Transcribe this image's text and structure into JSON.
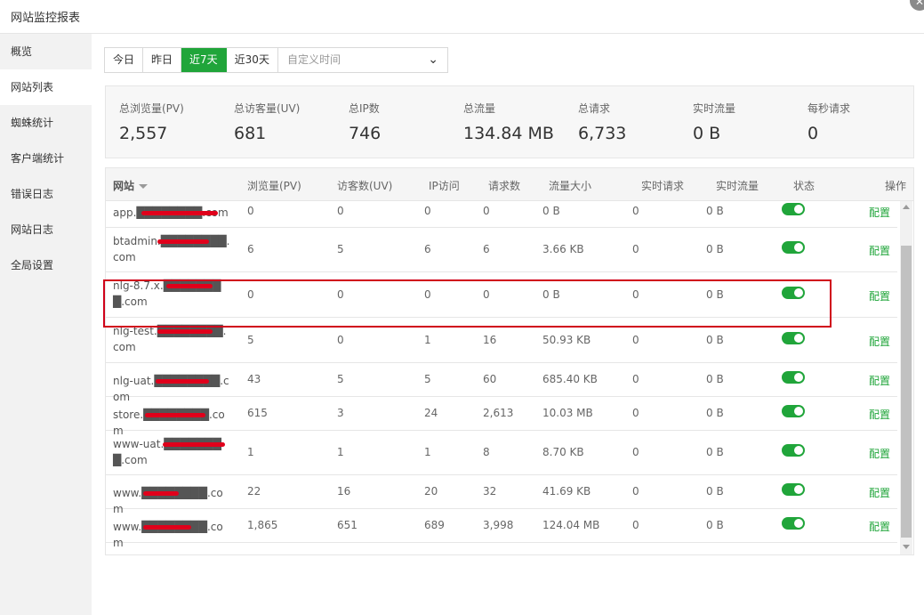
{
  "window": {
    "title": "网站监控报表",
    "close_symbol": "✕"
  },
  "sidebar": {
    "items": [
      {
        "label": "概览"
      },
      {
        "label": "网站列表"
      },
      {
        "label": "蜘蛛统计"
      },
      {
        "label": "客户端统计"
      },
      {
        "label": "错误日志"
      },
      {
        "label": "网站日志"
      },
      {
        "label": "全局设置"
      }
    ]
  },
  "range": {
    "buttons": [
      "今日",
      "昨日",
      "近7天",
      "近30天"
    ],
    "active": "近7天",
    "custom_placeholder": "自定义时间",
    "chevron": "⌄"
  },
  "summary": [
    {
      "label": "总浏览量(PV)",
      "value": "2,557"
    },
    {
      "label": "总访客量(UV)",
      "value": "681"
    },
    {
      "label": "总IP数",
      "value": "746"
    },
    {
      "label": "总流量",
      "value": "134.84 MB"
    },
    {
      "label": "总请求",
      "value": "6,733"
    },
    {
      "label": "实时流量",
      "value": "0 B"
    },
    {
      "label": "每秒请求",
      "value": "0"
    }
  ],
  "table": {
    "headers": [
      "网站",
      "浏览量(PV)",
      "访客数(UV)",
      "IP访问",
      "请求数",
      "流量大小",
      "实时请求",
      "实时流量",
      "状态",
      "操作"
    ],
    "action_label": "配置",
    "rows": [
      {
        "site": "app.████████.com",
        "pv": "0",
        "uv": "0",
        "ip": "0",
        "req": "0",
        "flow": "0 B",
        "rt_req": "0",
        "rt_flow": "0 B",
        "enabled": true
      },
      {
        "site": "btadmin.████████.com",
        "pv": "6",
        "uv": "5",
        "ip": "6",
        "req": "6",
        "flow": "3.66 KB",
        "rt_req": "0",
        "rt_flow": "0 B",
        "enabled": true
      },
      {
        "site": "nlg-8.7.x.████████.com",
        "pv": "0",
        "uv": "0",
        "ip": "0",
        "req": "0",
        "flow": "0 B",
        "rt_req": "0",
        "rt_flow": "0 B",
        "enabled": true
      },
      {
        "site": "nlg-test.████████.com",
        "pv": "5",
        "uv": "0",
        "ip": "1",
        "req": "16",
        "flow": "50.93 KB",
        "rt_req": "0",
        "rt_flow": "0 B",
        "enabled": true
      },
      {
        "site": "nlg-uat.████████.com",
        "pv": "43",
        "uv": "5",
        "ip": "5",
        "req": "60",
        "flow": "685.40 KB",
        "rt_req": "0",
        "rt_flow": "0 B",
        "enabled": true
      },
      {
        "site": "store.████████.com",
        "pv": "615",
        "uv": "3",
        "ip": "24",
        "req": "2,613",
        "flow": "10.03 MB",
        "rt_req": "0",
        "rt_flow": "0 B",
        "enabled": true
      },
      {
        "site": "www-uat.████████.com",
        "pv": "1",
        "uv": "1",
        "ip": "1",
        "req": "8",
        "flow": "8.70 KB",
        "rt_req": "0",
        "rt_flow": "0 B",
        "enabled": true
      },
      {
        "site": "www.████████.com",
        "pv": "22",
        "uv": "16",
        "ip": "20",
        "req": "32",
        "flow": "41.69 KB",
        "rt_req": "0",
        "rt_flow": "0 B",
        "enabled": true
      },
      {
        "site": "www.████████.com",
        "pv": "1,865",
        "uv": "651",
        "ip": "689",
        "req": "3,998",
        "flow": "124.04 MB",
        "rt_req": "0",
        "rt_flow": "0 B",
        "enabled": true
      }
    ]
  },
  "colors": {
    "accent": "#20a53a",
    "highlight": "#d0021b",
    "redaction": "#e0001b"
  }
}
